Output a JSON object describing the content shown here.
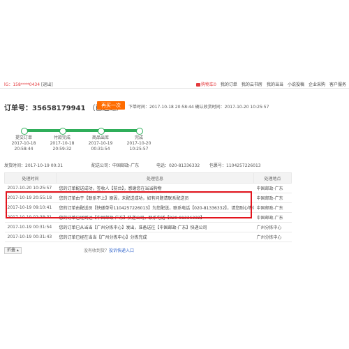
{
  "topbar": {
    "user": "lG：158****0434",
    "exit": "[退出]",
    "nav": [
      "购物车0",
      "我的订单",
      "我的云书房",
      "我的当当",
      "小说投稿",
      "企业采购",
      "客户服务"
    ]
  },
  "order": {
    "label": "订单号：35658179941",
    "status": "（已送达）",
    "buy_again": "再买一次",
    "order_time": "下单时间：2017-10-18 20:58:44",
    "confirm_time": "确认收货时间：2017-10-20 10:25:57"
  },
  "progress": {
    "steps": [
      {
        "label": "提交订单",
        "date": "2017-10-18",
        "time": "20:58:44"
      },
      {
        "label": "付款完成",
        "date": "2017-10-18",
        "time": "20:59:32"
      },
      {
        "label": "商品出库",
        "date": "2017-10-19",
        "time": "00:31:54"
      },
      {
        "label": "完成",
        "date": "2017-10-20",
        "time": "10:25:57"
      }
    ]
  },
  "shipping": {
    "ship_time": "发货时间：2017-10-19 00:31",
    "company": "配送公司：中国邮政-广东",
    "phone": "电话：020-81336332",
    "package": "包裹号：1104257226013"
  },
  "log": {
    "headers": [
      "处理时间",
      "处理信息",
      "处理地点"
    ],
    "rows": [
      {
        "time": "2017-10-20 10:25:57",
        "info": "您的订单配送成功，签收人【前台】，感谢您在当当购物",
        "place": "中国邮政-广东"
      },
      {
        "time": "2017-10-19 20:55:18",
        "info": "您的订单由于【联系不上】原因，未配送成功，如有问题请联系配送员",
        "place": "中国邮政-广东"
      },
      {
        "time": "2017-10-19 09:10:41",
        "info": "您的订单由配送员【快递单号1104257226013】为您配送，联系电话【020-81336332】，请您耐心等待",
        "place": "中国邮政-广东"
      },
      {
        "time": "2017-10-19 02:38:31",
        "info": "您的订单已经到达【中国邮政-广东】快递公司，联系电话【020-81336332】",
        "place": "中国邮政-广东"
      },
      {
        "time": "2017-10-19 00:31:54",
        "info": "您的订单已从当当【广州分拣中心】发出，准备送往【中国邮政-广东】快递公司",
        "place": "广州分拣中心"
      },
      {
        "time": "2017-10-19 00:31:43",
        "info": "您的订单已经在当当【广州分拣中心】分拣完成",
        "place": "广州分拣中心"
      }
    ]
  },
  "footer": {
    "collapse": "折叠 ▴",
    "complain_prefix": "没有收到货？",
    "complain_link": "投诉快递入口"
  }
}
